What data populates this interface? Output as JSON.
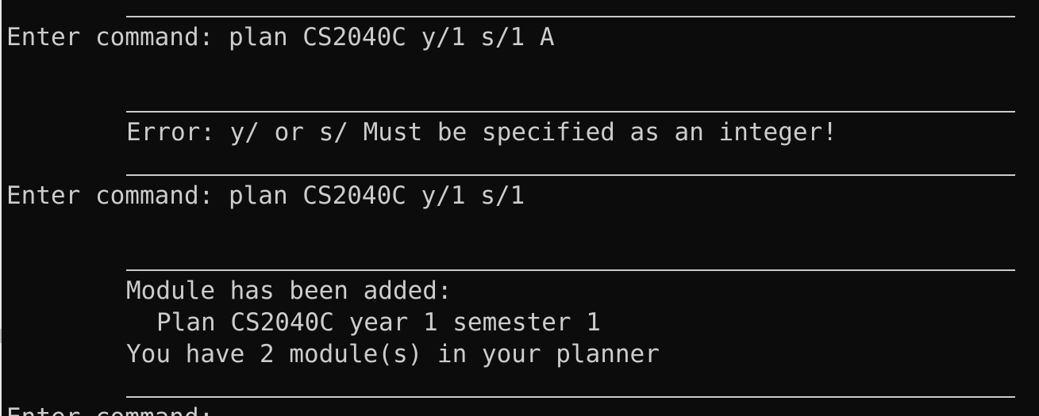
{
  "console": {
    "lines": {
      "prompt_1": "Enter command: plan CS2040C y/1 s/1 A",
      "error_1": "Error: y/ or s/ Must be specified as an integer!",
      "prompt_2": "Enter command: plan CS2040C y/1 s/1",
      "added_header": "Module has been added:",
      "added_detail": "Plan CS2040C year 1 semester 1",
      "planner_count": "You have 2 module(s) in your planner",
      "prompt_3": "Enter command:"
    }
  },
  "colors": {
    "background": "#0c0c0c",
    "text": "#cccccc"
  }
}
